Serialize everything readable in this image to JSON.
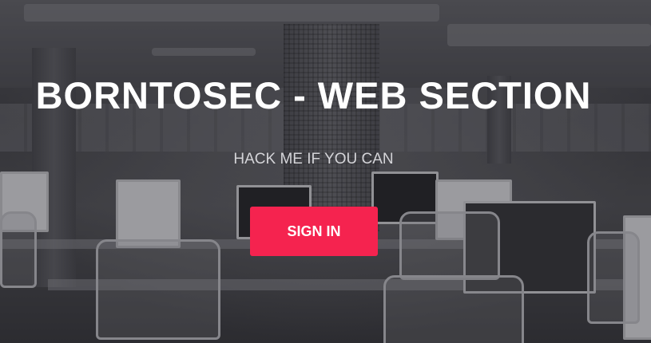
{
  "hero": {
    "title": "BORNTOSEC - WEB SECTION",
    "subtitle": "HACK ME IF YOU CAN",
    "signin_label": "SIGN IN"
  },
  "colors": {
    "accent": "#f5234f",
    "title_text": "#ffffff",
    "subtitle_text": "#d4d4d8"
  }
}
